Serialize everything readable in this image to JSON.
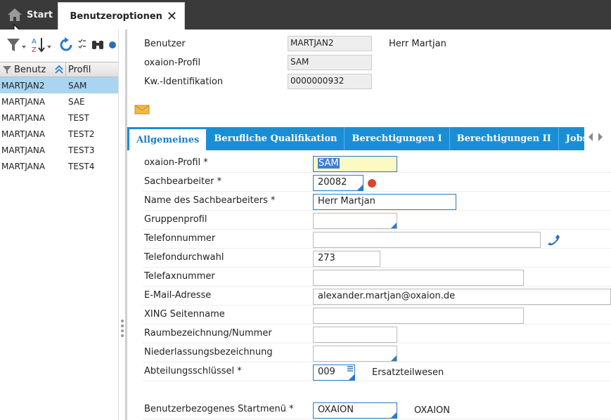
{
  "tabs": {
    "start": "Start",
    "active": "Benutzeroptionen"
  },
  "left_grid": {
    "col1": "Benutz",
    "col2": "Profil",
    "rows": [
      {
        "user": "MARTJAN2",
        "profile": "SAM"
      },
      {
        "user": "MARTJANA",
        "profile": "SAE"
      },
      {
        "user": "MARTJANA",
        "profile": "TEST"
      },
      {
        "user": "MARTJANA",
        "profile": "TEST2"
      },
      {
        "user": "MARTJANA",
        "profile": "TEST3"
      },
      {
        "user": "MARTJANA",
        "profile": "TEST4"
      }
    ]
  },
  "header": {
    "user_label": "Benutzer",
    "user_value": "MARTJAN2",
    "user_name": "Herr Martjan",
    "profile_label": "oxaion-Profil",
    "profile_value": "SAM",
    "kw_label": "Kw.-Identifikation",
    "kw_value": "0000000932"
  },
  "form_tabs": [
    "Allgemeines",
    "Berufliche Qualifikation",
    "Berechtigungen I",
    "Berechtigungen II",
    "Jobs / Benut"
  ],
  "form": {
    "oxaion_profil": {
      "label": "oxaion-Profil *",
      "value": "SAM"
    },
    "sachbearbeiter": {
      "label": "Sachbearbeiter *",
      "value": "20082"
    },
    "name_sb": {
      "label": "Name des Sachbearbeiters *",
      "value": "Herr Martjan"
    },
    "gruppenprofil": {
      "label": "Gruppenprofil",
      "value": ""
    },
    "telefon": {
      "label": "Telefonnummer",
      "value": ""
    },
    "durchwahl": {
      "label": "Telefondurchwahl",
      "value": "273"
    },
    "fax": {
      "label": "Telefaxnummer",
      "value": ""
    },
    "email": {
      "label": "E-Mail-Adresse",
      "value": "alexander.martjan@oxaion.de"
    },
    "xing": {
      "label": "XING Seitenname",
      "value": ""
    },
    "raum": {
      "label": "Raumbezeichnung/Nummer",
      "value": ""
    },
    "niederlassung": {
      "label": "Niederlassungsbezeichnung",
      "value": ""
    },
    "abteilung": {
      "label": "Abteilungsschlüssel *",
      "value": "009",
      "desc": "Ersatzteilwesen"
    },
    "startmenu": {
      "label": "Benutzerbezogenes Startmenü *",
      "value": "OXAION",
      "desc": "OXAION"
    }
  },
  "colors": {
    "accent": "#1a8ed5",
    "selection": "#a9d5f2",
    "required_border": "#2a7bc4",
    "status_dot": "#d9462b"
  }
}
